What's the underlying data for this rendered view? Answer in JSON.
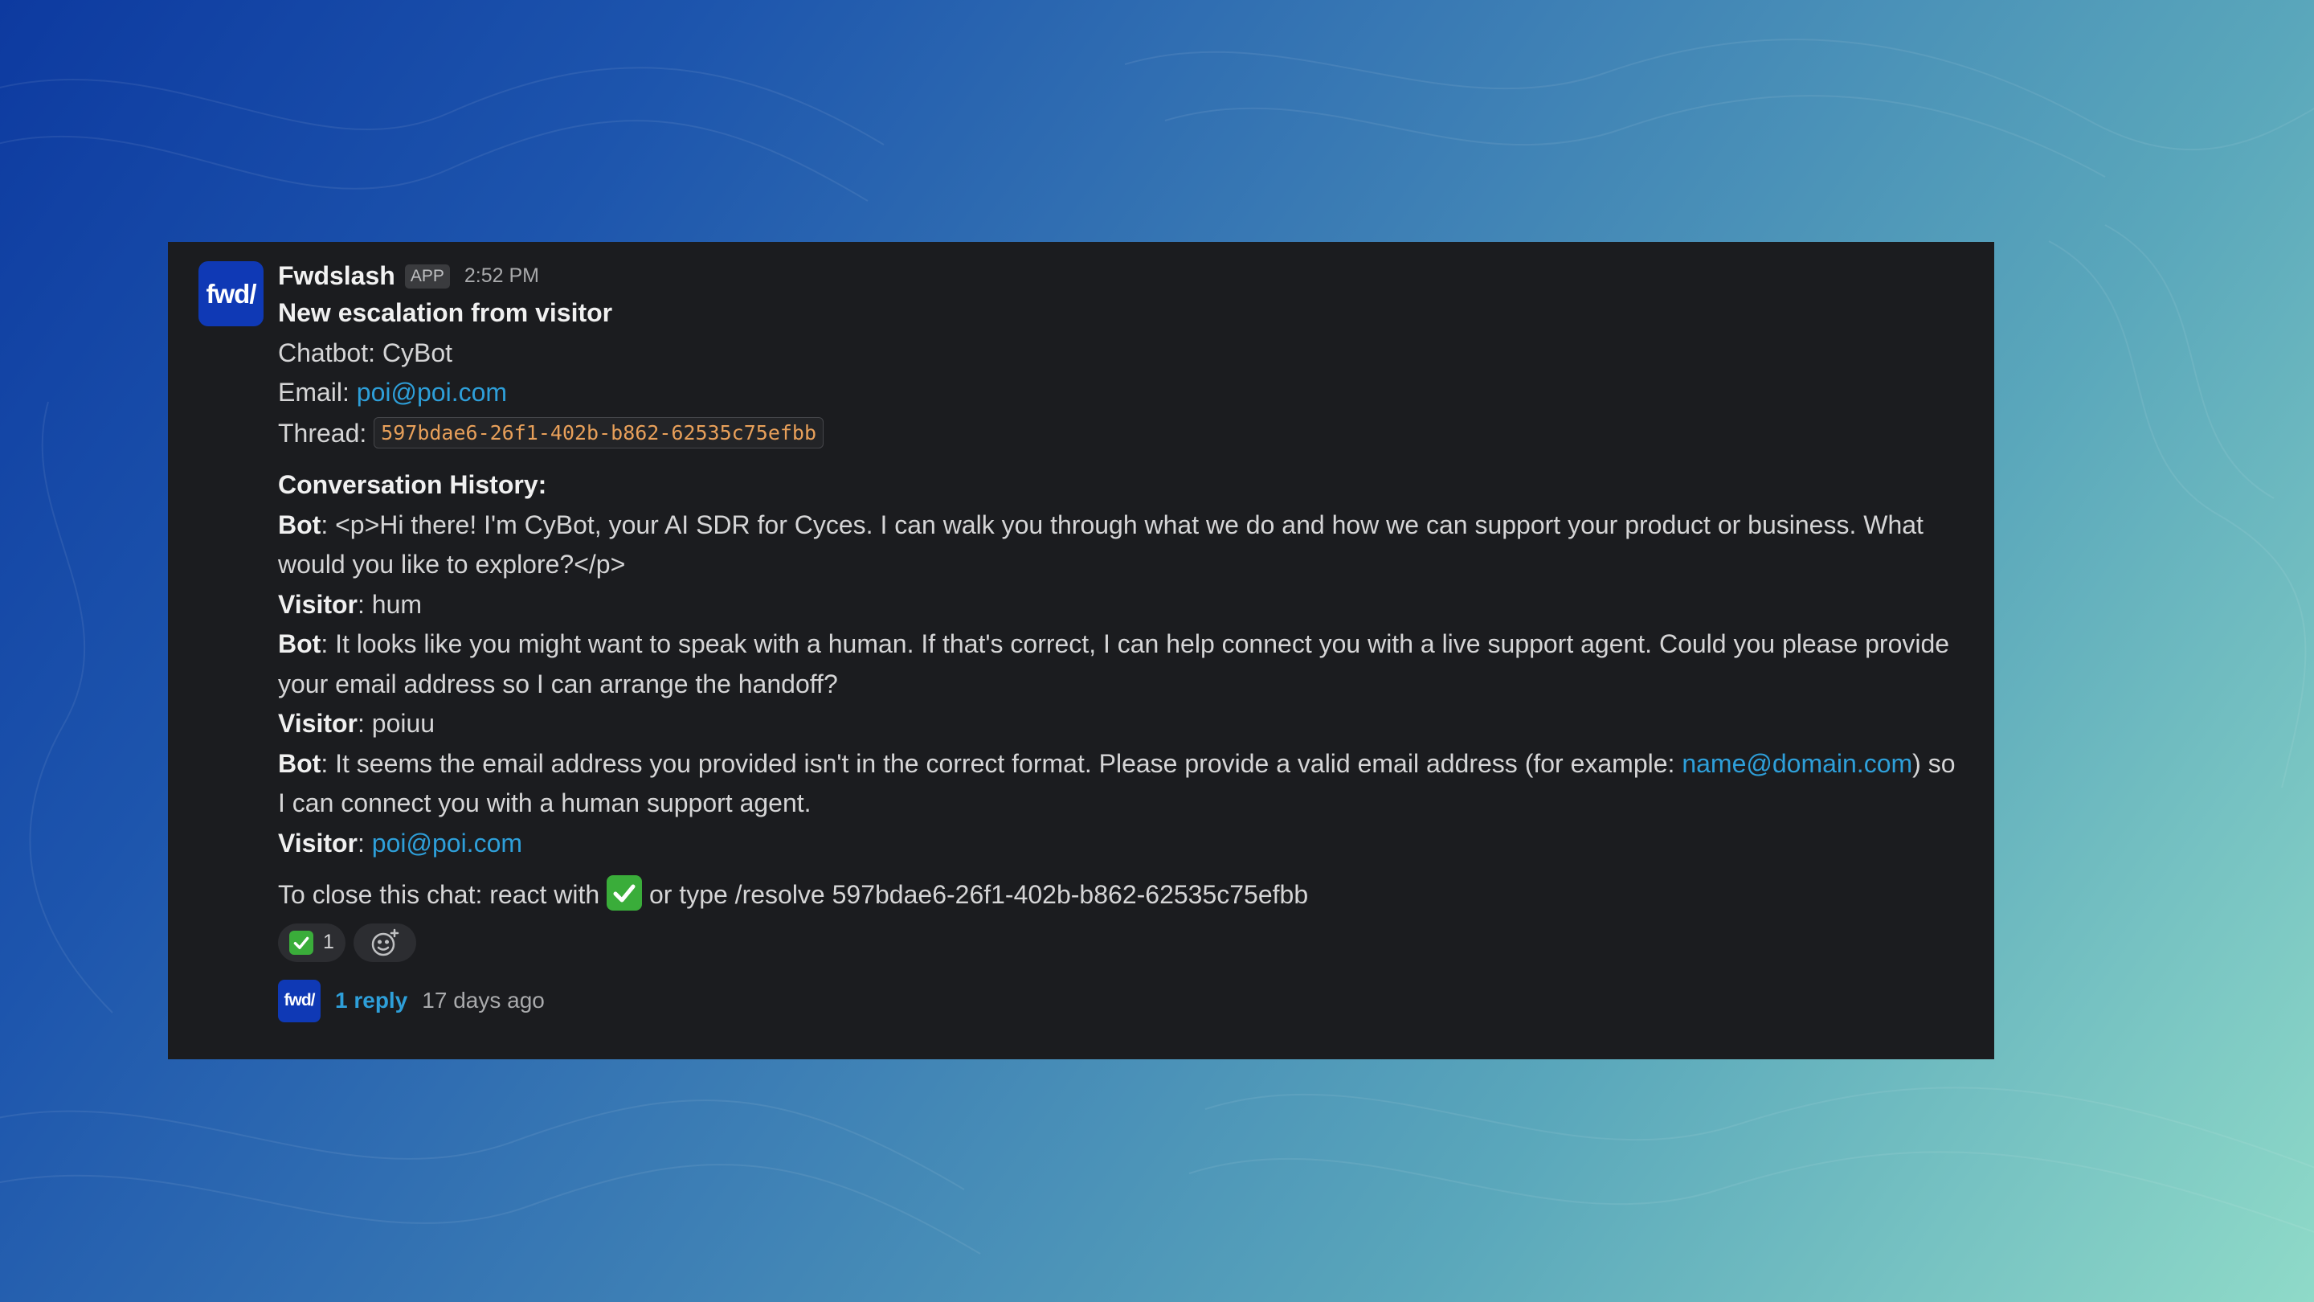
{
  "message": {
    "avatar_text": "fwd/",
    "sender": "Fwdslash",
    "badge": "APP",
    "time": "2:52 PM",
    "title": "New escalation from visitor",
    "chatbot_label": "Chatbot:",
    "chatbot_value": "CyBot",
    "email_label": "Email:",
    "email_value": "poi@poi.com",
    "thread_label": "Thread:",
    "thread_id": "597bdae6-26f1-402b-b862-62535c75efbb",
    "history_title": "Conversation History:",
    "history": [
      {
        "speaker": "Bot",
        "text": ": <p>Hi there! I'm CyBot, your AI SDR for Cyces. I can walk you through what we do and how we can support your product or business. What would you like to explore?</p>"
      },
      {
        "speaker": "Visitor",
        "text": ": hum"
      },
      {
        "speaker": "Bot",
        "text": ": It looks like you might want to speak with a human. If that's correct, I can help connect you with a live support agent. Could you please provide your email address so I can arrange the handoff?"
      },
      {
        "speaker": "Visitor",
        "text": ": poiuu"
      },
      {
        "speaker": "Bot",
        "text_before": ": It seems the email address you provided isn't in the correct format. Please provide a valid email address (for example: ",
        "link": "name@domain.com",
        "text_after": ") so I can connect you with a human support agent."
      },
      {
        "speaker": "Visitor",
        "text": ": ",
        "link": "poi@poi.com"
      }
    ],
    "close_before": "To close this chat: react with",
    "close_after": "or type /resolve 597bdae6-26f1-402b-b862-62535c75efbb"
  },
  "reactions": [
    {
      "icon": "white-check-mark-emoji",
      "count": "1"
    }
  ],
  "thread_summary": {
    "avatar_text": "fwd/",
    "reply_count": "1 reply",
    "last_reply": "17 days ago"
  },
  "colors": {
    "card_bg": "#1b1c1f",
    "link": "#2e9fd9",
    "code": "#e8a05a",
    "brand": "#0f39b5",
    "check": "#3aad3a"
  }
}
